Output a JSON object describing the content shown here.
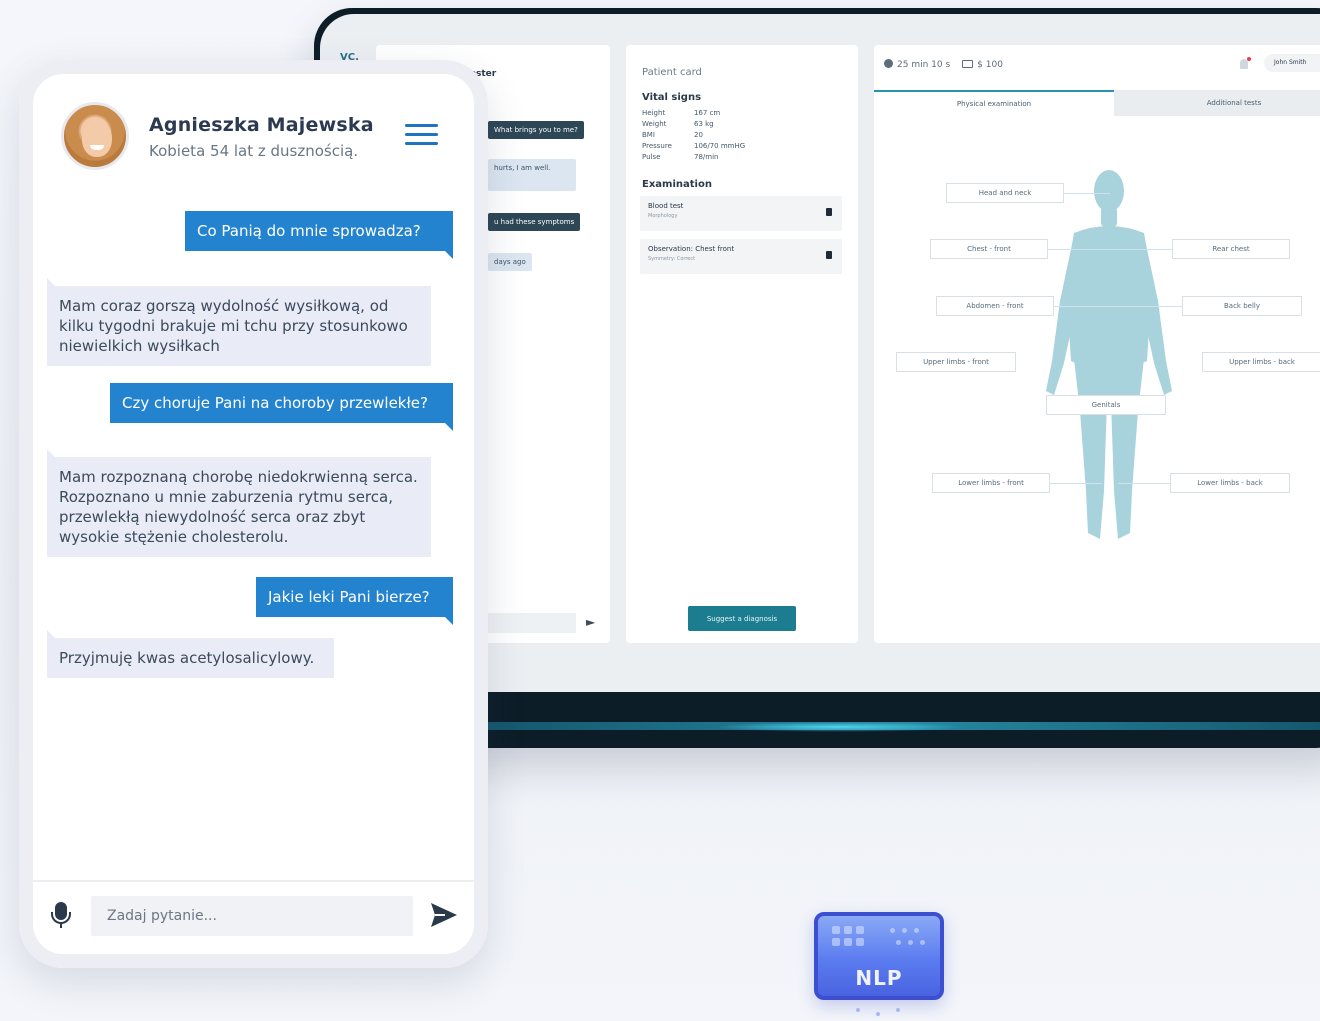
{
  "tablet": {
    "logo": "VC.",
    "chat": {
      "patient_name": "Foster",
      "q1": "What brings you to me?",
      "a1": "hurts, I am well.",
      "q2": "u had these symptoms",
      "a2": "days ago"
    },
    "card": {
      "title": "Patient card",
      "vitals_title": "Vital signs",
      "vitals": [
        {
          "label": "Height",
          "value": "167 cm"
        },
        {
          "label": "Weight",
          "value": "63 kg"
        },
        {
          "label": "BMI",
          "value": "20"
        },
        {
          "label": "Pressure",
          "value": "106/70 mmHG"
        },
        {
          "label": "Pulse",
          "value": "78/min"
        }
      ],
      "exam_title": "Examination",
      "exam_items": [
        {
          "title": "Blood test",
          "sub": "Morphology"
        },
        {
          "title": "Observation: Chest front",
          "sub": "Symmetry: Correct"
        }
      ],
      "suggest_label": "Suggest a diagnosis"
    },
    "body": {
      "timer": "25 min 10 s",
      "price": "$ 100",
      "user": "John Smith",
      "tabs": [
        "Physical examination",
        "Additional tests"
      ],
      "regions": {
        "head": "Head and neck",
        "chest_front": "Chest - front",
        "rear_chest": "Rear chest",
        "abdomen_front": "Abdomen - front",
        "back_belly": "Back belly",
        "upper_front": "Upper limbs - front",
        "upper_back": "Upper limbs - back",
        "genitals": "Genitals",
        "lower_front": "Lower limbs - front",
        "lower_back": "Lower limbs - back"
      }
    }
  },
  "phone": {
    "patient_name": "Agnieszka Majewska",
    "patient_desc": "Kobieta 54 lat z dusznością.",
    "messages": [
      {
        "from": "doctor",
        "text": "Co Panią do mnie sprowadza?"
      },
      {
        "from": "patient",
        "text": "Mam coraz gorszą wydolność wysiłkową, od kilku tygodni brakuje mi tchu przy stosunkowo niewielkich wysiłkach"
      },
      {
        "from": "doctor",
        "text": "Czy choruje Pani na choroby przewlekłe?"
      },
      {
        "from": "patient",
        "text": "Mam rozpoznaną chorobę niedokrwienną serca. Rozpoznano u mnie zaburzenia rytmu serca, przewlekłą niewydolność serca oraz zbyt wysokie stężenie cholesterolu."
      },
      {
        "from": "doctor",
        "text": "Jakie leki Pani bierze?"
      },
      {
        "from": "patient",
        "text": "Przyjmuję kwas acetylosalicylowy."
      }
    ],
    "input_placeholder": "Zadaj pytanie..."
  },
  "nlp": {
    "label": "NLP"
  },
  "colors": {
    "accent": "#2483cf",
    "teal": "#1c7d90",
    "body": "#a8d2dc",
    "nlp": "#4a63e0"
  }
}
